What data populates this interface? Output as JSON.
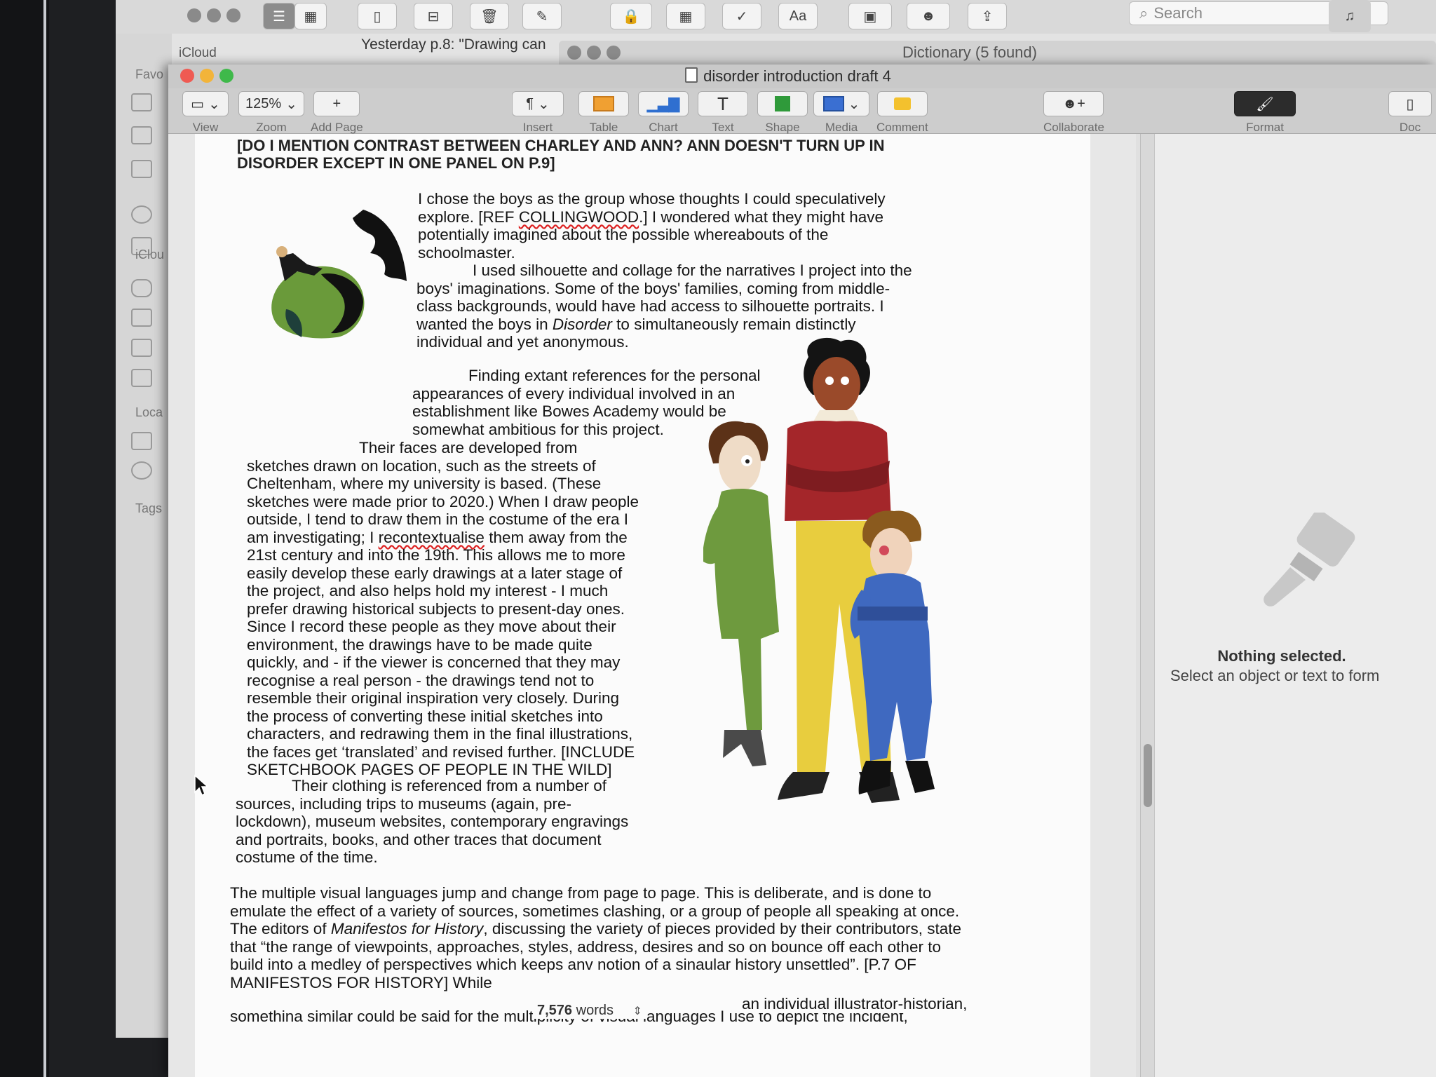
{
  "notes_window": {
    "toolbar": {
      "search_placeholder": "Search"
    },
    "sidebar": {
      "favorites_label": "Favo",
      "icloud_label": "iClou",
      "local_label": "Loca",
      "tags_label": "Tags"
    },
    "list_header": "iCloud",
    "note_preview": "Yesterday  p.8: \"Drawing can"
  },
  "dictionary_window": {
    "title": "Dictionary (5 found)"
  },
  "pages_window": {
    "title": "disorder introduction draft 4",
    "toolbar": {
      "view_label": "View",
      "zoom_value": "125%",
      "zoom_label": "Zoom",
      "add_page_label": "Add Page",
      "insert_label": "Insert",
      "table_label": "Table",
      "chart_label": "Chart",
      "text_label": "Text",
      "shape_label": "Shape",
      "media_label": "Media",
      "comment_label": "Comment",
      "collaborate_label": "Collaborate",
      "format_label": "Format",
      "document_label": "Doc"
    },
    "document": {
      "note_top": "[DO I MENTION CONTRAST BETWEEN CHARLEY AND ANN? ANN DOESN'T TURN UP IN DISORDER EXCEPT IN ONE PANEL ON P.9]",
      "p1a": "I chose the boys as the group whose thoughts I could speculatively explore. [REF ",
      "p1_ref": "COLLINGWOOD",
      "p1b": ".] I wondered what they might have potentially imagined about the possible whereabouts of the schoolmaster.",
      "p2a": "I used silhouette and collage for the narratives I project into the boys' imaginations. Some of the boys' families, coming from middle-class backgrounds, would have had access to silhouette portraits. I wanted the boys in ",
      "p2_italic": "Disorder",
      "p2b": " to simultaneously remain distinctly individual and yet anonymous.",
      "p3": "Finding extant references for the personal appearances of every individual involved in an establishment like Bowes Academy would be somewhat ambitious for this project.",
      "p4a": "Their faces are developed from sketches drawn on location, such as the streets of Cheltenham, where my university is based. (These sketches were made prior to 2020.) When I draw people outside, I tend to draw them in the costume of the era I am investigating; I ",
      "p4_word": "recontextualise",
      "p4b": " them away from the 21st century and into the 19th. This allows me to more easily develop these early drawings at a later stage of the project, and also helps hold my interest - I much prefer drawing historical subjects to present-day ones. Since I record these people as they move about their environment, the drawings have to be made quite quickly, and - if the viewer is concerned that they may recognise a real person - the drawings tend not to resemble their original inspiration very closely. During the process of converting these initial sketches into characters, and redrawing them in the final illustrations, the faces get ‘translated’ and revised further.  [INCLUDE SKETCHBOOK PAGES OF PEOPLE IN THE WILD]",
      "p5": "Their clothing is referenced from a number of sources, including trips to museums (again, pre-lockdown), museum websites, contemporary engravings and portraits, books, and other traces that document costume of the time.",
      "p6a": "The multiple visual languages jump and change from page to page. This is deliberate, and is done to emulate the effect of a variety of sources, sometimes clashing, or a group of people all speaking at once. The editors of ",
      "p6_italic1": "Manifestos for History",
      "p6b": ", discussing the variety of pieces provided by their contributors, state that “the range of viewpoints, approaches, styles, address, desires and so on bounce off each other to build into a medley of perspectives which keeps anv notion of a sinaular history unsettled”. [P.7 OF MANIFESTOS FOR HISTORY] While",
      "p6c": "somethina similar could be said for the multiplicity of visual languages I use to depict the incident,",
      "p6_tail": "an individual illustrator-historian,"
    },
    "word_count": {
      "number": "7,576",
      "label": "words"
    },
    "inspector": {
      "empty_title": "Nothing selected.",
      "empty_subtitle": "Select an object or text to form"
    }
  },
  "colors": {
    "close": "#ef5a52",
    "minimize": "#f2b43a",
    "zoom": "#3fb94a",
    "green_coat": "#6e9a3e",
    "red_coat": "#a4262a",
    "yellow_trousers": "#e8cd3e",
    "blue_suit": "#3f69c0"
  }
}
